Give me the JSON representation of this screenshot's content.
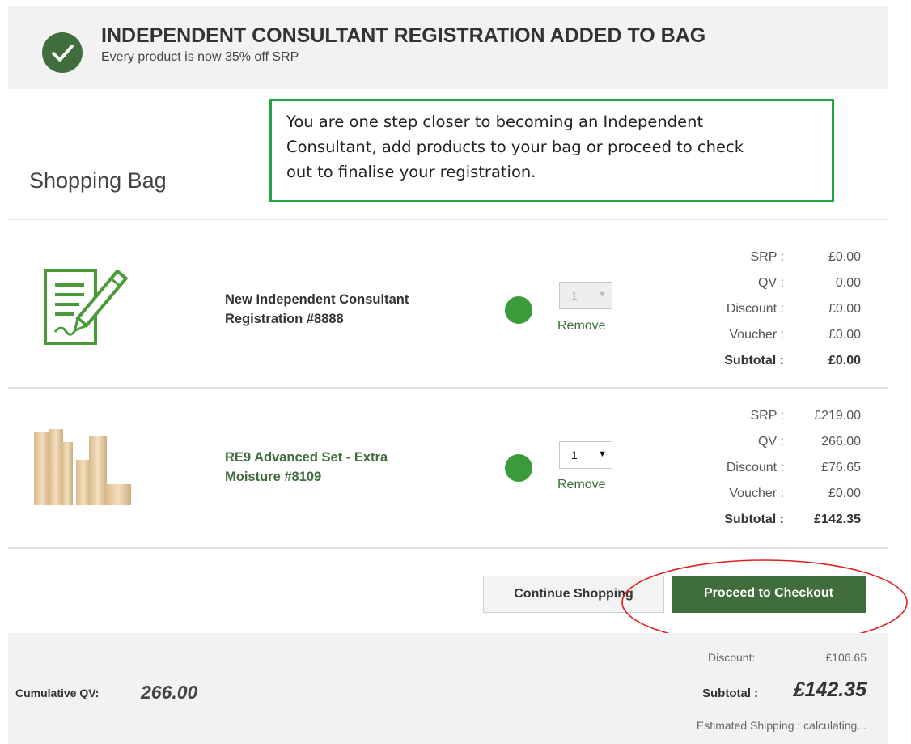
{
  "banner": {
    "title": "INDEPENDENT CONSULTANT REGISTRATION ADDED TO BAG",
    "subtitle": "Every product is now 35% off SRP",
    "icon": "check-circle-icon"
  },
  "notice": {
    "line1": "You are one step closer to becoming an Independent",
    "line2": "Consultant, add products to your bag or proceed to check",
    "line3": "out to finalise your registration."
  },
  "bag": {
    "title": "Shopping Bag"
  },
  "items": [
    {
      "name_line1": "New Independent Consultant",
      "name_line2": "Registration #8888",
      "image_icon": "registration-form-icon",
      "status_color": "#3a9b3a",
      "qty": "1",
      "qty_arrow": "▼",
      "remove": "Remove",
      "prices": [
        {
          "label": "SRP :",
          "value": "£0.00"
        },
        {
          "label": "QV :",
          "value": "0.00"
        },
        {
          "label": "Discount :",
          "value": "£0.00"
        },
        {
          "label": "Voucher :",
          "value": "£0.00"
        },
        {
          "label": "Subtotal :",
          "value": "£0.00"
        }
      ]
    },
    {
      "name_line1": "RE9 Advanced Set - Extra",
      "name_line2": "Moisture #8109",
      "image_icon": "product-bottles-image",
      "status_color": "#3a9b3a",
      "qty": "1",
      "qty_arrow": "▼",
      "remove": "Remove",
      "prices": [
        {
          "label": "SRP :",
          "value": "£219.00"
        },
        {
          "label": "QV :",
          "value": "266.00"
        },
        {
          "label": "Discount :",
          "value": "£76.65"
        },
        {
          "label": "Voucher :",
          "value": "£0.00"
        },
        {
          "label": "Subtotal :",
          "value": "£142.35"
        }
      ]
    }
  ],
  "actions": {
    "continue": "Continue Shopping",
    "checkout": "Proceed to Checkout"
  },
  "summary": {
    "cumulative_label": "Cumulative QV:",
    "cumulative_value": "266.00",
    "discount_label": "Discount:",
    "discount_value": "£106.65",
    "subtotal_label": "Subtotal :",
    "subtotal_value": "£142.35",
    "shipping": "Estimated Shipping : calculating..."
  },
  "colors": {
    "brand_green": "#3f6e3c",
    "notice_border": "#22a645",
    "annotation": "#e02020"
  }
}
